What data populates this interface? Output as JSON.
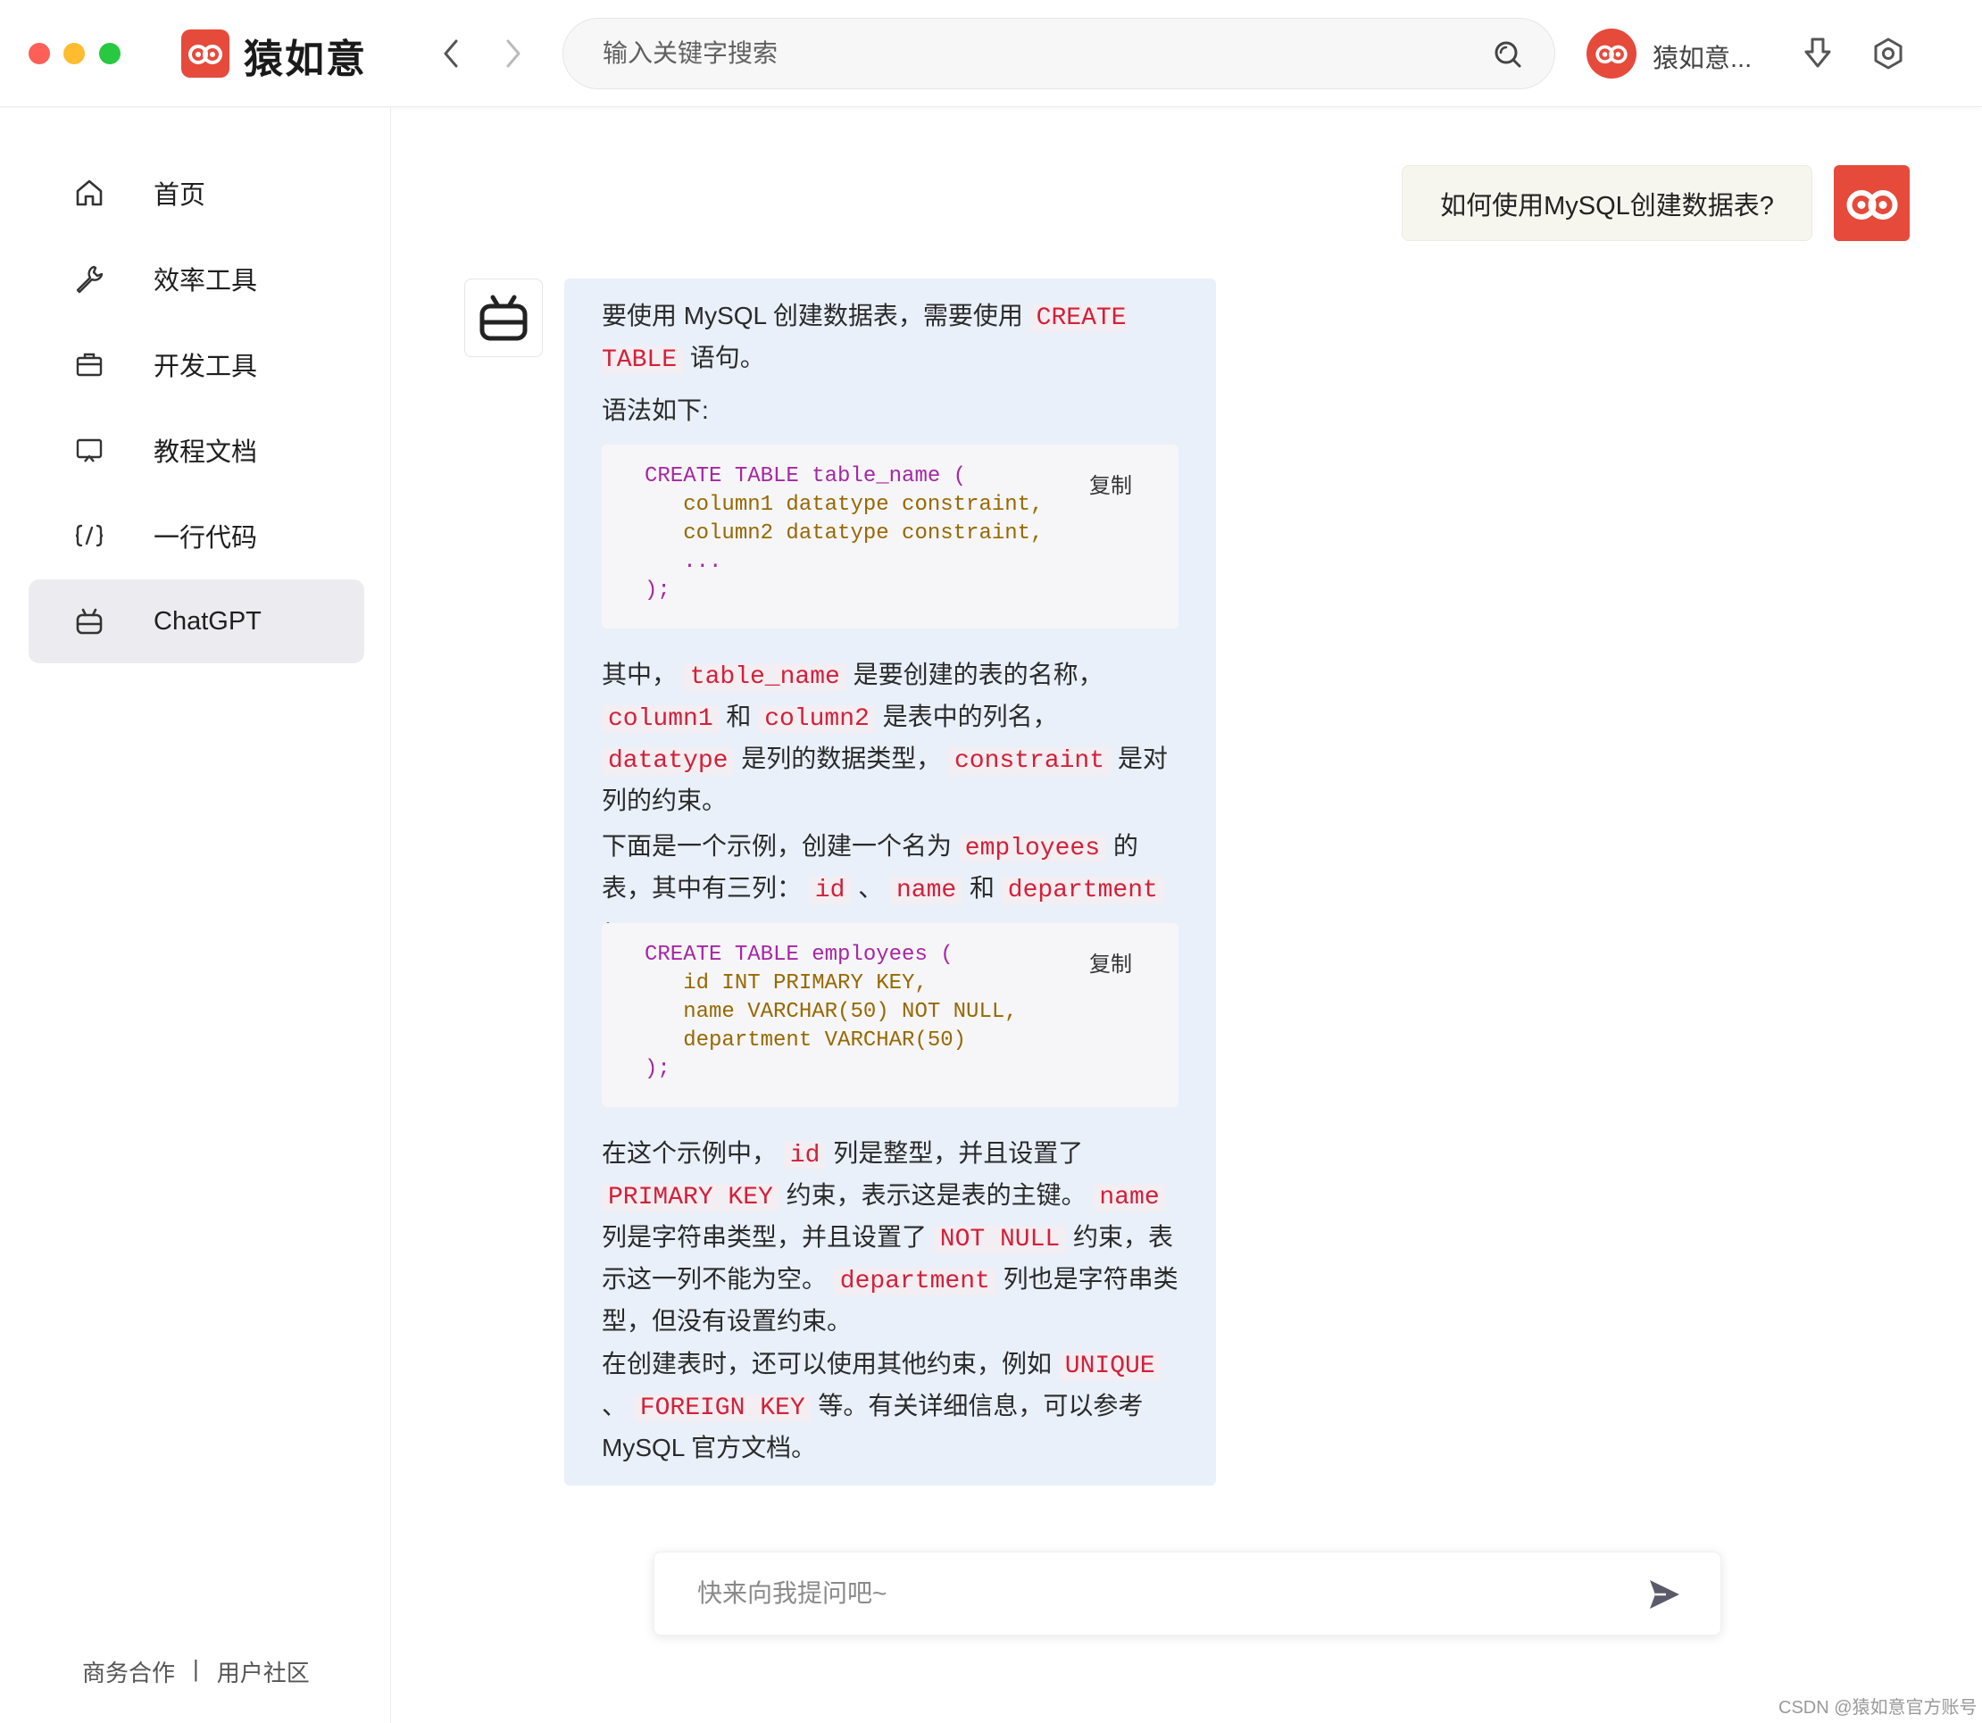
{
  "app": {
    "title": "猿如意",
    "brand_color": "#e64a3b"
  },
  "search": {
    "placeholder": "输入关键字搜索"
  },
  "user": {
    "name": "猿如意..."
  },
  "sidebar": {
    "items": [
      {
        "label": "首页",
        "icon": "home-icon"
      },
      {
        "label": "效率工具",
        "icon": "wrench-icon"
      },
      {
        "label": "开发工具",
        "icon": "toolbox-icon"
      },
      {
        "label": "教程文档",
        "icon": "screen-icon"
      },
      {
        "label": "一行代码",
        "icon": "code-icon"
      },
      {
        "label": "ChatGPT",
        "icon": "robot-icon",
        "active": true
      }
    ],
    "footer": {
      "business": "商务合作",
      "separator": "|",
      "community": "用户社区"
    }
  },
  "chat": {
    "question": "如何使用MySQL创建数据表?",
    "answer": {
      "p1_a": "要使用 MySQL 创建数据表，需要使用",
      "p1_code": "CREATE TABLE",
      "p1_b": "语句。",
      "p2": "语法如下:",
      "code1": {
        "lines": [
          "CREATE TABLE table_name (",
          "   column1 datatype constraint,",
          "   column2 datatype constraint,",
          "   ...",
          ");"
        ]
      },
      "p3": {
        "t1": "其中，",
        "c1": "table_name",
        "t2": "是要创建的表的名称，",
        "c2": "column1",
        "t3": "和",
        "c3": "column2",
        "t4": "是表中的列名，",
        "c4": "datatype",
        "t5": "是列的数据类型，",
        "c5": "constraint",
        "t6": "是对列的约束。"
      },
      "p4": {
        "t1": "下面是一个示例，创建一个名为",
        "c1": "employees",
        "t2": "的表，其中有三列：",
        "c2": "id",
        "t3": "、",
        "c3": "name",
        "t4": "和",
        "c4": "department",
        "t5": "："
      },
      "code2": {
        "lines": [
          "CREATE TABLE employees (",
          "   id INT PRIMARY KEY,",
          "   name VARCHAR(50) NOT NULL,",
          "   department VARCHAR(50)",
          ");"
        ]
      },
      "p5": {
        "t1": "在这个示例中，",
        "c1": "id",
        "t2": "列是整型，并且设置了",
        "c2": "PRIMARY KEY",
        "t3": "约束，表示这是表的主键。",
        "c3": "name",
        "t4": "列是字符串类型，并且设置了",
        "c4": "NOT NULL",
        "t5": "约束，表示这一列不能为空。",
        "c5": "department",
        "t6": "列也是字符串类型，但没有设置约束。"
      },
      "p6": {
        "t1": "在创建表时，还可以使用其他约束，例如",
        "c1": "UNIQUE",
        "t2": "、",
        "c2": "FOREIGN KEY",
        "t3": "等。有关详细信息，可以参考 MySQL 官方文档。"
      }
    },
    "copy_label": "复制",
    "composer_placeholder": "快来向我提问吧~"
  },
  "watermark": "CSDN @猿如意官方账号"
}
